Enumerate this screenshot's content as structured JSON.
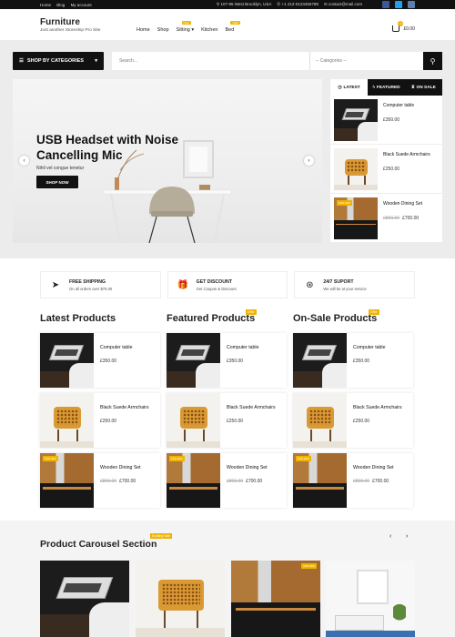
{
  "topbar": {
    "links": [
      "Home",
      "Blog",
      "My account"
    ],
    "address": "107-95 West Brooklyn, USA",
    "phone": "+1 212-0123456789",
    "email": "contact@mail.com"
  },
  "brand": {
    "name": "Furniture",
    "tagline": "Just another Storeship Pro Site"
  },
  "nav": {
    "items": [
      "Home",
      "Shop",
      "Sitting",
      "Kitchen",
      "Bed"
    ],
    "sitting_badge": "New",
    "bed_badge": "Offer"
  },
  "cart": {
    "count": "0",
    "total": "£0.00"
  },
  "search": {
    "category_button": "SHOP BY CATEGORIES",
    "placeholder": "Search...",
    "category_select": "-- Categories --"
  },
  "hero": {
    "title": "USB Headset with Noise Cancelling Mic",
    "subtitle": "Nihil vel congue tenetur",
    "cta": "SHOP NOW"
  },
  "side_tabs": {
    "tabs": [
      "LATEST",
      "FEATURED",
      "ON SALE"
    ],
    "items": [
      {
        "name": "Computer table",
        "price": "£350.00",
        "old_price": ""
      },
      {
        "name": "Black Suede Armchairs",
        "price": "£250.00",
        "old_price": ""
      },
      {
        "name": "Wooden Dining Set",
        "price": "£700.00",
        "old_price": "£800.00",
        "off": "13% OFF"
      }
    ]
  },
  "features": [
    {
      "title": "FREE SHIPPING",
      "sub": "On all orders over $75.00"
    },
    {
      "title": "GET DISCOUNT",
      "sub": "Get Coupon & Discount"
    },
    {
      "title": "24/7 SUPORT",
      "sub": "We will be at your service"
    }
  ],
  "columns": [
    {
      "title": "Latest Products",
      "badge": ""
    },
    {
      "title": "Featured Products",
      "badge": "Offer"
    },
    {
      "title": "On-Sale Products",
      "badge": "Offer"
    }
  ],
  "products": [
    {
      "name": "Computer table",
      "price": "£350.00",
      "old_price": ""
    },
    {
      "name": "Black Suede Armchairs",
      "price": "£250.00",
      "old_price": ""
    },
    {
      "name": "Wooden Dining Set",
      "price": "£700.00",
      "old_price": "£800.00",
      "off": "13% OFF"
    }
  ],
  "carousel": {
    "title": "Product Carousel Section",
    "badge": "Exciting Sale",
    "prev": "‹",
    "next": "›",
    "off": "13% OFF"
  },
  "colors": {
    "accent": "#f0b400",
    "dark": "#111111"
  }
}
